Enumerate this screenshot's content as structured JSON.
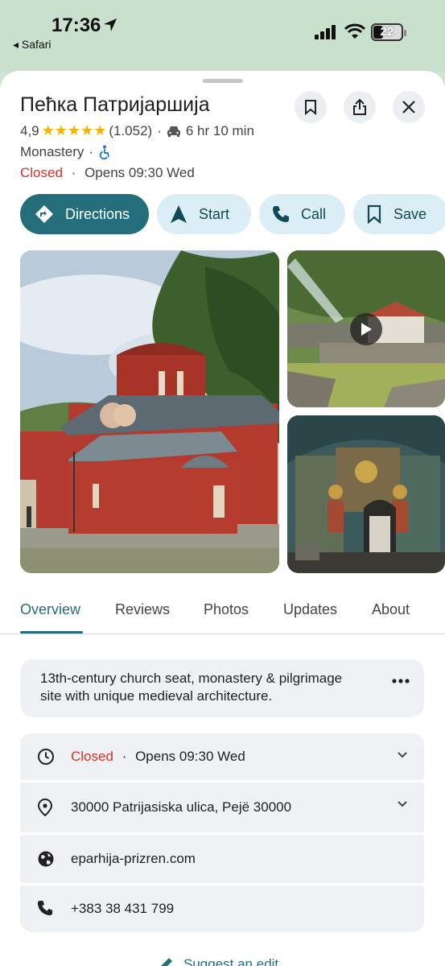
{
  "status_bar": {
    "time": "17:36",
    "back_app": "◂ Safari",
    "battery": "22"
  },
  "place": {
    "name": "Пећка Патријаршија",
    "rating": "4,9",
    "stars": "★★★★★",
    "reviews_count": "(1.052)",
    "drive_time": "6 hr 10 min",
    "category": "Monastery",
    "status": "Closed",
    "opens": "Opens 09:30 Wed"
  },
  "actions": {
    "directions": "Directions",
    "start": "Start",
    "call": "Call",
    "save": "Save"
  },
  "tabs": [
    "Overview",
    "Reviews",
    "Photos",
    "Updates",
    "About"
  ],
  "description": {
    "line1": "13th-century church seat, monastery & pilgrimage",
    "line2": "site with unique medieval architecture."
  },
  "info": {
    "hours_status": "Closed",
    "hours_opens": "Opens 09:30 Wed",
    "address": "30000 Patrijasiska ulica, Pejë 30000",
    "website": "eparhija-prizren.com",
    "phone": "+383 38 431 799"
  },
  "suggest_edit": "Suggest an edit",
  "colors": {
    "accent": "#246e7c",
    "chip_bg": "#dbeef5",
    "closed": "#d93025",
    "star": "#f4b400"
  }
}
